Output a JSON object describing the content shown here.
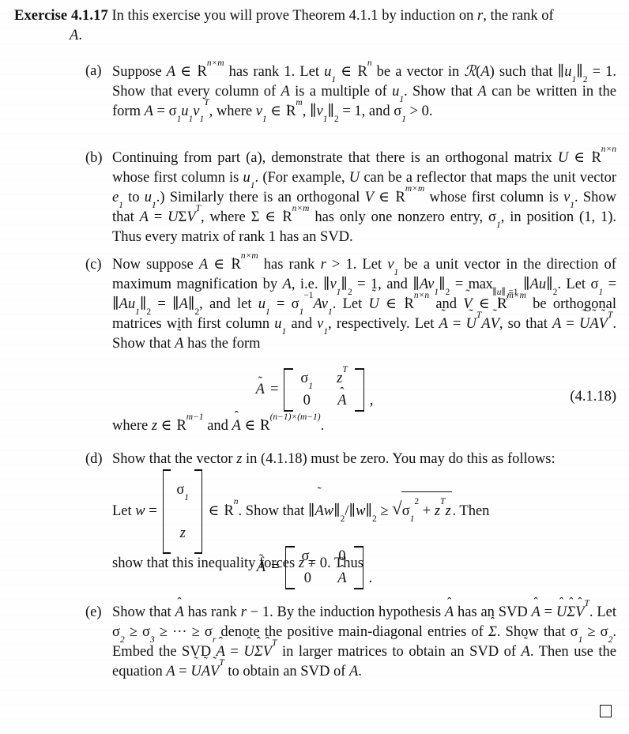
{
  "document": {
    "exercise_label": "Exercise 4.1.17",
    "intro": "In this exercise you will prove Theorem 4.1.1 by induction on r, the rank of",
    "intro_cont": "A.",
    "equation_tag": "(4.1.18)",
    "qed_symbol": "open-square"
  },
  "parts": {
    "a": {
      "label": "(a)",
      "text": "Suppose A ∈ R^{n×m} has rank 1. Let u1 ∈ R^n be a vector in R(A) such that ||u1||2 = 1. Show that every column of A is a multiple of u1. Show that A can be written in the form A = σ1 u1 v1^T, where v1 ∈ R^m, ||v1||2 = 1, and σ1 > 0."
    },
    "b": {
      "label": "(b)",
      "text": "Continuing from part (a), demonstrate that there is an orthogonal matrix U ∈ R^{n×n} whose first column is u1. (For example, U can be a reflector that maps the unit vector e1 to u1.) Similarly there is an orthogonal V ∈ R^{m×m} whose first column is v1. Show that A = UΣV^T, where Σ ∈ R^{n×m} has only one nonzero entry, σ1, in position (1,1). Thus every matrix of rank 1 has an SVD."
    },
    "c": {
      "label": "(c)",
      "text": "Now suppose A ∈ R^{n×m} has rank r > 1. Let v1 be a unit vector in the direction of maximum magnification by A, i.e. ||v1||2 = 1, and ||Av1||2 = max_{||u||2=1} ||Au||2. Let σ1 = ||Au1||2 = ||A||2, and let u1 = σ1^{-1} Av1. Let Ũ ∈ R^{n×n} and Ṽ ∈ R^{m×m} be orthogonal matrices with first column u1 and v1, respectively. Let Ã = Ũ^T A Ṽ, so that A = Ũ Ã Ṽ^T. Show that Ã has the form",
      "after_equation": "where z ∈ R^{m-1} and Â ∈ R^{(n-1)×(m-1)}."
    },
    "d": {
      "label": "(d)",
      "text_before": "Show that the vector z in (4.1.18) must be zero. You may do this as follows: Let w = [σ1; z] ∈ R^n. Show that ||Ãw||2/||w||2 ≥ sqrt(σ1^2 + z^T z). Then show that this inequality forces z = 0. Thus"
    },
    "e": {
      "label": "(e)",
      "text": "Show that Â has rank r − 1. By the induction hypothesis Â has an SVD Â = Û Σ̂ V̂^T. Let σ2 ≥ σ3 ≥ ··· ≥ σr denote the positive main-diagonal entries of Σ̂. Show that σ1 ≥ σ2. Embed the SVD Â = Û Σ̂ V̂^T in larger matrices to obtain an SVD of Ã. Then use the equation A = Ũ Ã Ṽ^T to obtain an SVD of A."
    }
  },
  "equations": {
    "eq_4118": {
      "lhs": "Ã",
      "relation": "=",
      "cells": [
        "σ1",
        "z^T",
        "0",
        "Â"
      ],
      "trailing_punct": ",",
      "tag": "(4.1.18)"
    },
    "eq_block_diagonal": {
      "lhs": "Ã",
      "relation": "=",
      "cells": [
        "σ1",
        "0",
        "0",
        "Â"
      ],
      "trailing_punct": "."
    }
  }
}
